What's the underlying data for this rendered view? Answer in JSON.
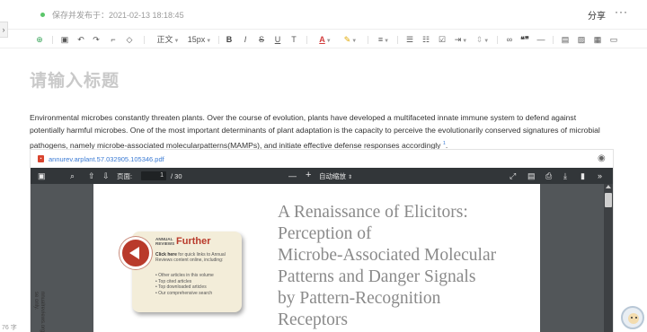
{
  "status": {
    "save_status": "保存并发布于：2021-02-13 18:18:45",
    "share": "分享",
    "more": "···"
  },
  "toolbar": {
    "paragraph_style": "正文",
    "font_size": "15px",
    "bold": "B",
    "italic": "I",
    "strike": "S",
    "underline": "U",
    "bg_text": "T",
    "font_color": "A",
    "highlight": "✎",
    "quote": "❝❞"
  },
  "document": {
    "title_placeholder": "请输入标题",
    "paragraph": "Environmental microbes constantly threaten plants. Over the course of evolution, plants have developed a multifaceted innate immune system to defend against potentially harmful microbes. One of the most important determinants of plant adaptation is the capacity to perceive the evolutionarily conserved signatures of microbial pathogens, namely microbe-associated molecularpatterns(MAMPs), and initiate effective defense responses accordingly ",
    "footnote": "1",
    "paragraph_end": "."
  },
  "pdf": {
    "filename": "annurev.arplant.57.032905.105346.pdf",
    "page_label": "页面:",
    "page_current": "1",
    "page_total": "/ 30",
    "zoom_label": "自动缩放",
    "article_title_lines": [
      "A Renaissance of Elicitors:",
      "Perception of",
      "Microbe-Associated Molecular",
      "Patterns and Danger Signals",
      "by Pattern-Recognition",
      "Receptors"
    ],
    "further": {
      "small_label_1": "ANNUAL",
      "small_label_2": "REVIEWS",
      "big_label": "Further",
      "click_text_bold": "Click here",
      "click_text": " for quick links to Annual Reviews content online, including:",
      "items": [
        "• Other articles in this volume",
        "• Top cited articles",
        "• Top downloaded articles",
        "• Our comprehensive search"
      ]
    },
    "vertical_note": "nnualreviews.org\nse only."
  },
  "footer": {
    "word_count": "76 字"
  }
}
